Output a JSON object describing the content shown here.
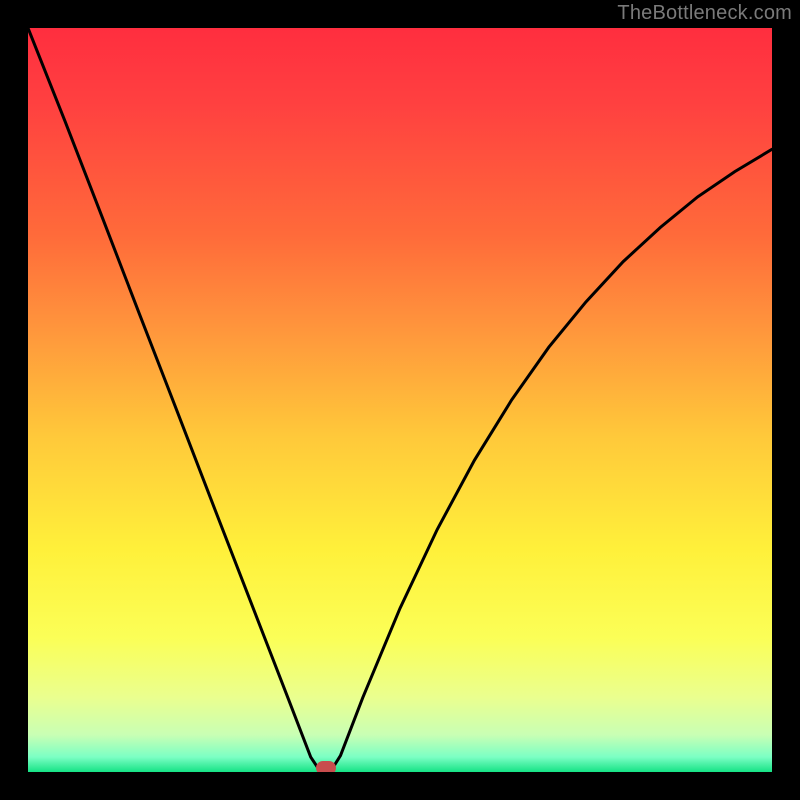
{
  "watermark": "TheBottleneck.com",
  "chart_data": {
    "type": "line",
    "title": "",
    "xlabel": "",
    "ylabel": "",
    "xlim": [
      0,
      100
    ],
    "ylim": [
      0,
      100
    ],
    "legend": false,
    "grid": false,
    "background_gradient": {
      "top": "#ff2e3f",
      "mid": "#ffe23a",
      "bottom": "#15e285"
    },
    "series": [
      {
        "name": "bottleneck-curve",
        "color": "#000000",
        "x": [
          0,
          5,
          10,
          15,
          20,
          25,
          30,
          35,
          38,
          39,
          40,
          41,
          42,
          45,
          50,
          55,
          60,
          65,
          70,
          75,
          80,
          85,
          90,
          95,
          100
        ],
        "values": [
          100,
          87.4,
          74.5,
          61.5,
          48.6,
          35.6,
          22.7,
          9.8,
          2.0,
          0.5,
          0,
          0.6,
          2.2,
          10.0,
          22.0,
          32.6,
          41.9,
          50.0,
          57.1,
          63.2,
          68.6,
          73.2,
          77.3,
          80.7,
          83.7
        ]
      }
    ],
    "marker": {
      "name": "optimal-point",
      "x": 40,
      "y": 0,
      "color": "#c84d4d"
    },
    "annotations": []
  }
}
